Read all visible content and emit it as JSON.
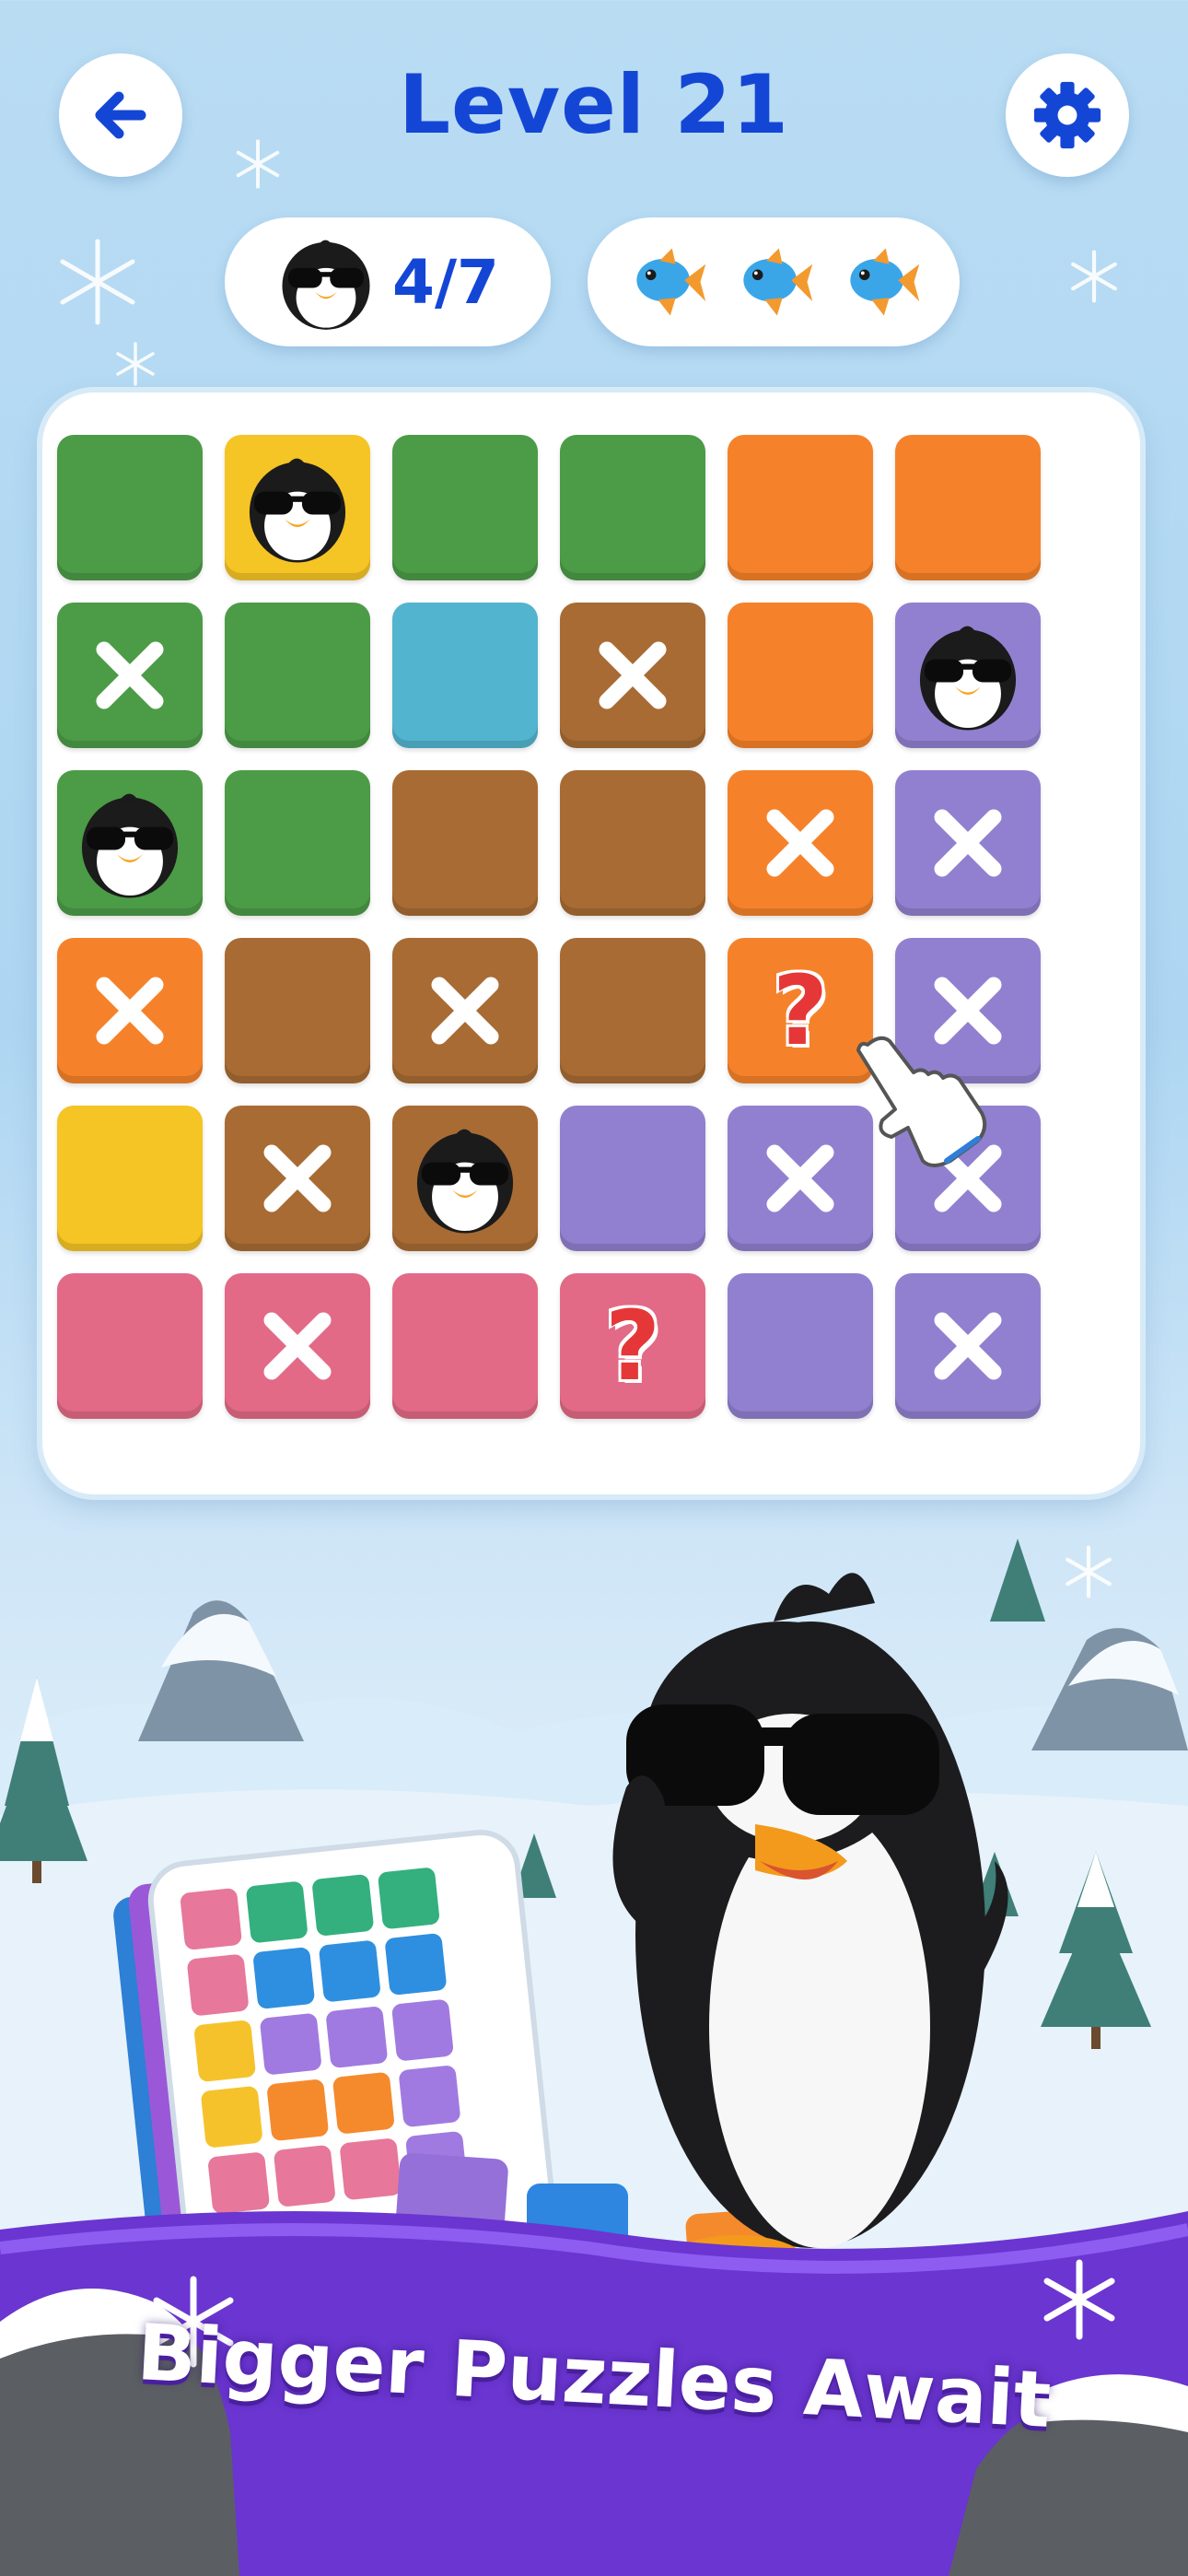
{
  "header": {
    "back_icon": "arrow-left-icon",
    "title": "Level 21",
    "settings_icon": "gear-icon",
    "accent_color": "#1446d6"
  },
  "stats": {
    "penguins_found": "4/7",
    "penguin_icon": "penguin-sunglasses-icon",
    "fish_icon": "fish-icon",
    "fish_lives": 3
  },
  "board": {
    "rows": 6,
    "cols": 6,
    "cells": [
      [
        "green",
        "yellow:penguin",
        "green",
        "green",
        "orange",
        "orange"
      ],
      [
        "green:x",
        "green",
        "teal",
        "brown:x",
        "orange",
        "purple:penguin"
      ],
      [
        "green:penguin",
        "green",
        "brown",
        "brown",
        "orange:x",
        "purple:x"
      ],
      [
        "orange:x",
        "brown",
        "brown:x",
        "brown",
        "orange:q",
        "purple:x"
      ],
      [
        "yellow",
        "brown:x",
        "brown:penguin",
        "purple",
        "purple:x",
        "purple:x"
      ],
      [
        "pink",
        "pink:x",
        "pink",
        "pink:q",
        "purple",
        "purple:x"
      ]
    ],
    "question_mark": "?",
    "colors": {
      "green": "#4c9b47",
      "yellow": "#f5c425",
      "orange": "#f5822a",
      "teal": "#52b4cf",
      "brown": "#a86b34",
      "purple": "#9180cf",
      "pink": "#e26a86"
    }
  },
  "promo": {
    "banner_text": "Bigger Puzzles Await",
    "banner_color": "#6a35d0"
  }
}
